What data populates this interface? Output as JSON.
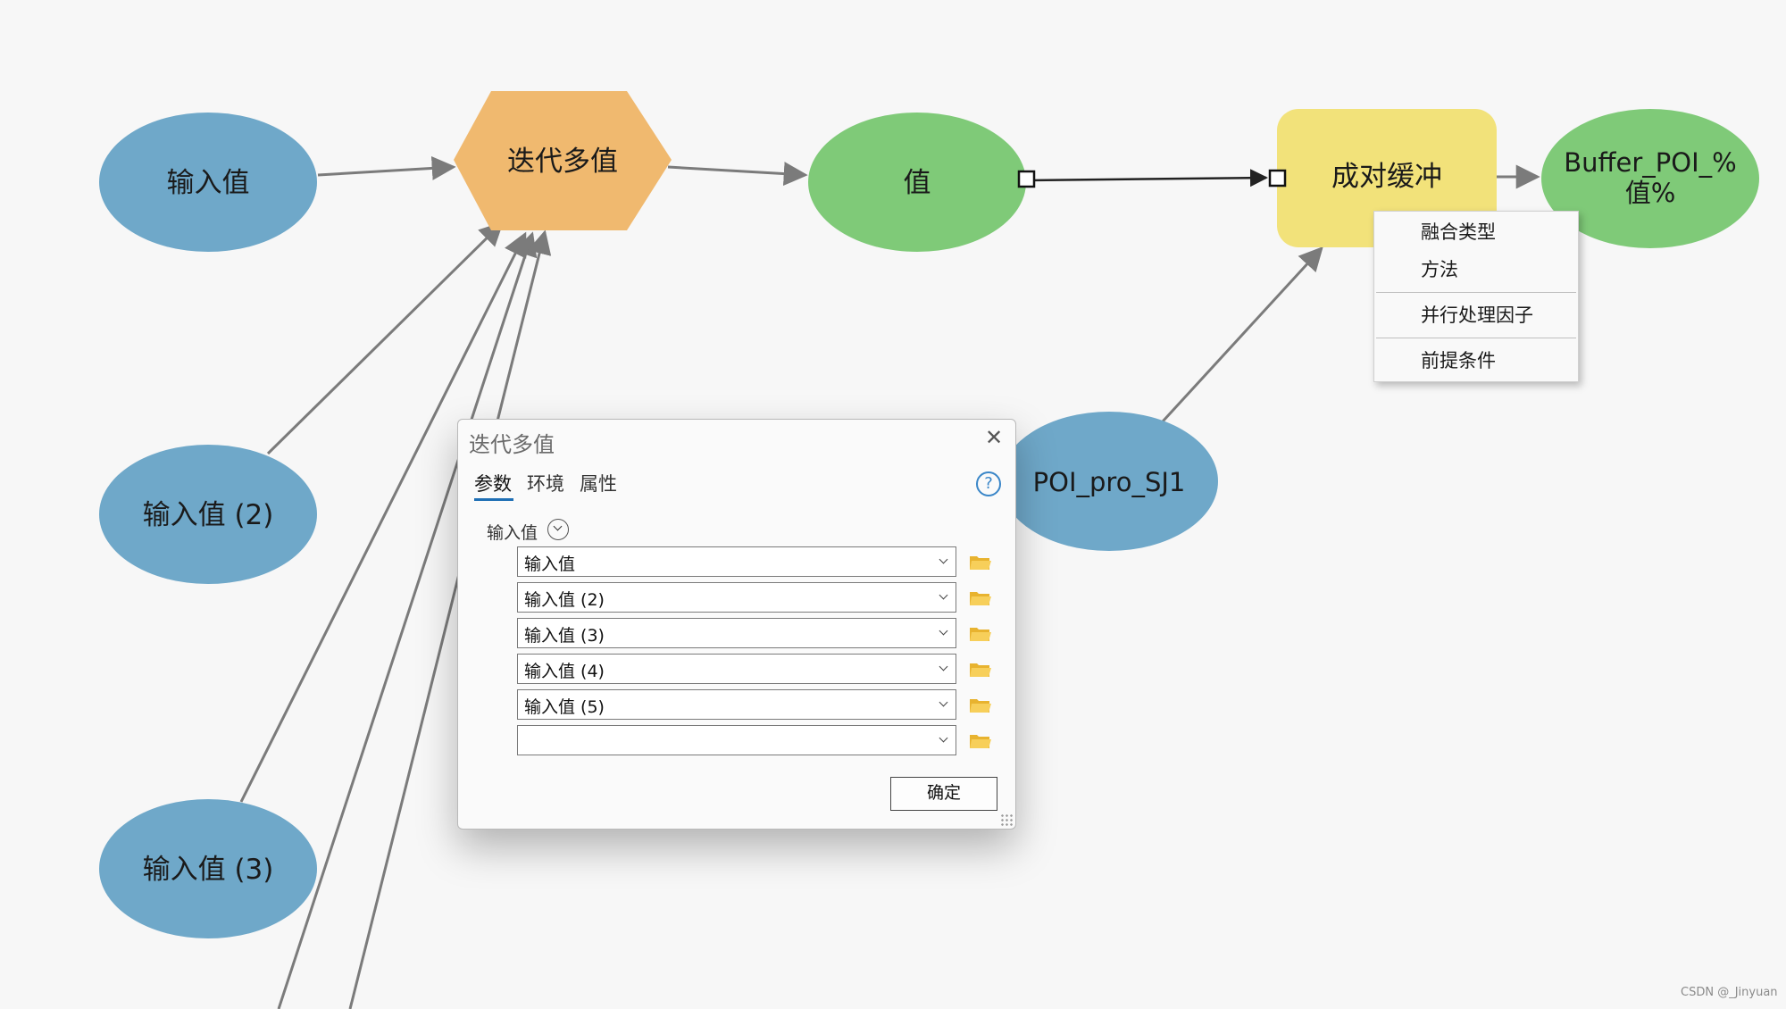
{
  "nodes": {
    "input1": "输入值",
    "input2": "输入值 (2)",
    "input3": "输入值 (3)",
    "iterate": "迭代多值",
    "value": "值",
    "pairwise_buffer": "成对缓冲",
    "buffer_output_line1": "Buffer_POI_%",
    "buffer_output_line2": "值%",
    "poi": "POI_pro_SJ1"
  },
  "context_menu": {
    "items": [
      "融合类型",
      "方法",
      "并行处理因子",
      "前提条件"
    ]
  },
  "dialog": {
    "title": "迭代多值",
    "tabs": [
      "参数",
      "环境",
      "属性"
    ],
    "section_label": "输入值",
    "rows": [
      "输入值",
      "输入值 (2)",
      "输入值 (3)",
      "输入值 (4)",
      "输入值 (5)",
      ""
    ],
    "ok_label": "确定"
  },
  "watermark": "CSDN @_Jinyuan",
  "colors": {
    "input_blue": "#6fa8c9",
    "iterator_orange": "#f0b96f",
    "value_green": "#7fca78",
    "tool_yellow": "#f2e27a",
    "connector_gray": "#7b7b7b"
  },
  "icons": [
    "close-icon",
    "help-icon",
    "collapse-icon",
    "chevron-down-icon",
    "folder-icon",
    "resize-grip-icon"
  ]
}
